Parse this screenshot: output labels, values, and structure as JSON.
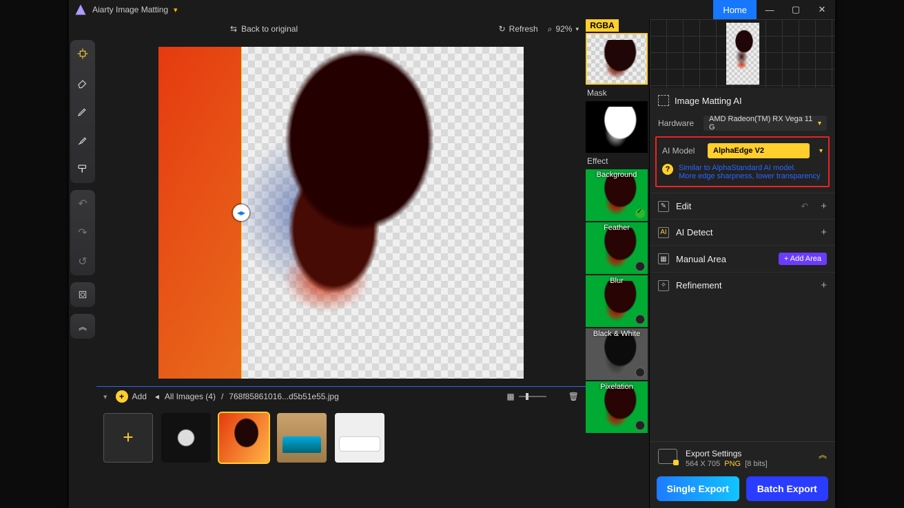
{
  "title": {
    "app_name": "Aiarty Image Matting",
    "home": "Home"
  },
  "canvasbar": {
    "back": "Back to original",
    "refresh": "Refresh",
    "zoom": "92%"
  },
  "previews": {
    "rgba_tab": "RGBA",
    "mask": "Mask",
    "effect": "Effect",
    "items": [
      {
        "label": "Background"
      },
      {
        "label": "Feather"
      },
      {
        "label": "Blur"
      },
      {
        "label": "Black & White"
      },
      {
        "label": "Pixelation"
      }
    ]
  },
  "right": {
    "matting_title": "Image Matting AI",
    "hardware_label": "Hardware",
    "hardware_value": "AMD Radeon(TM) RX Vega 11 G",
    "aimodel_label": "AI Model",
    "aimodel_value": "AlphaEdge  V2",
    "hint_line1": "Similar to AlphaStandard AI model.",
    "hint_line2": "More edge sharpness, lower transparency",
    "edit": "Edit",
    "aidetect": "AI Detect",
    "manual": "Manual Area",
    "addarea": "Add Area",
    "refine": "Refinement",
    "export_settings": "Export Settings",
    "export_dims": "564 X 705",
    "export_fmt": "PNG",
    "export_bits": "[8 bits]",
    "single_export": "Single Export",
    "batch_export": "Batch Export"
  },
  "footer": {
    "add": "Add",
    "all_images": "All Images (4)",
    "filename": "768f85861016...d5b51e55.jpg"
  }
}
